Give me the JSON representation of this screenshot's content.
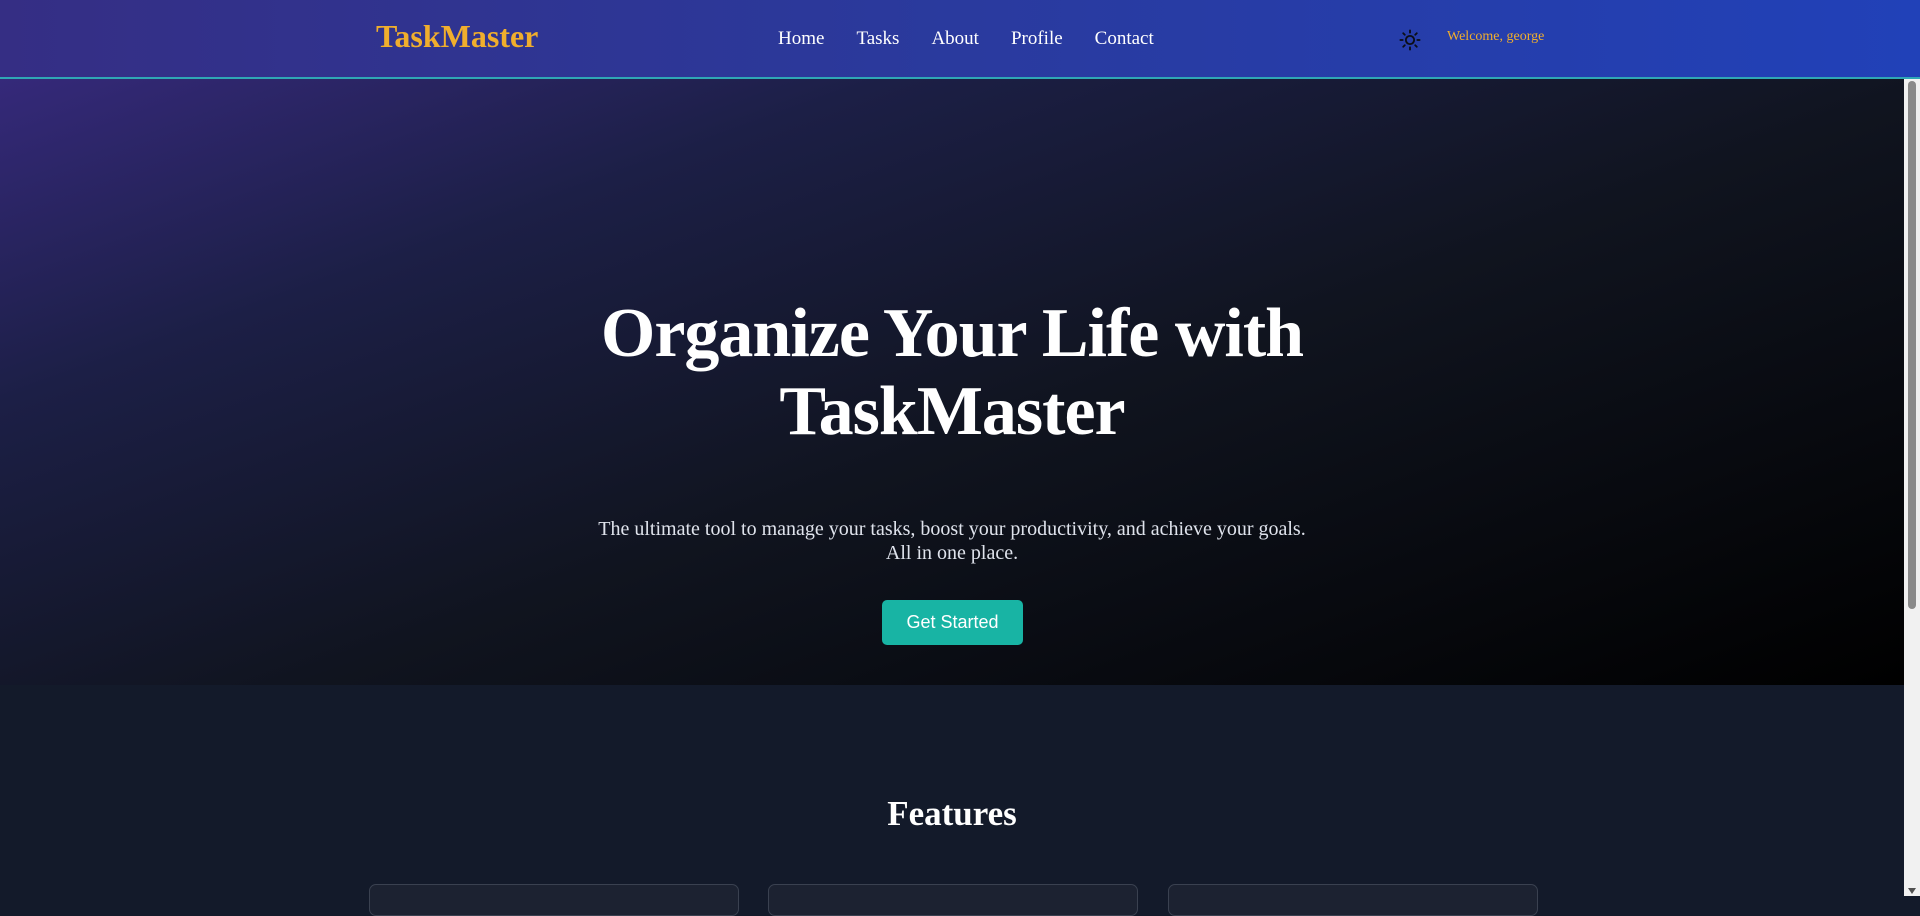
{
  "nav": {
    "brand": "TaskMaster",
    "links": [
      "Home",
      "Tasks",
      "About",
      "Profile",
      "Contact"
    ],
    "welcome": "Welcome, george",
    "theme_icon": "sun-icon"
  },
  "hero": {
    "title_line1": "Organize Your Life with",
    "title_line2": "TaskMaster",
    "subtitle_line1": "The ultimate tool to manage your tasks, boost your productivity, and achieve your goals.",
    "subtitle_line2": "All in one place.",
    "cta": "Get Started"
  },
  "features": {
    "title": "Features"
  },
  "colors": {
    "accent": "#f0ae2d",
    "cta": "#18b4a4",
    "nav_start": "#352e84",
    "nav_end": "#2141b8"
  }
}
